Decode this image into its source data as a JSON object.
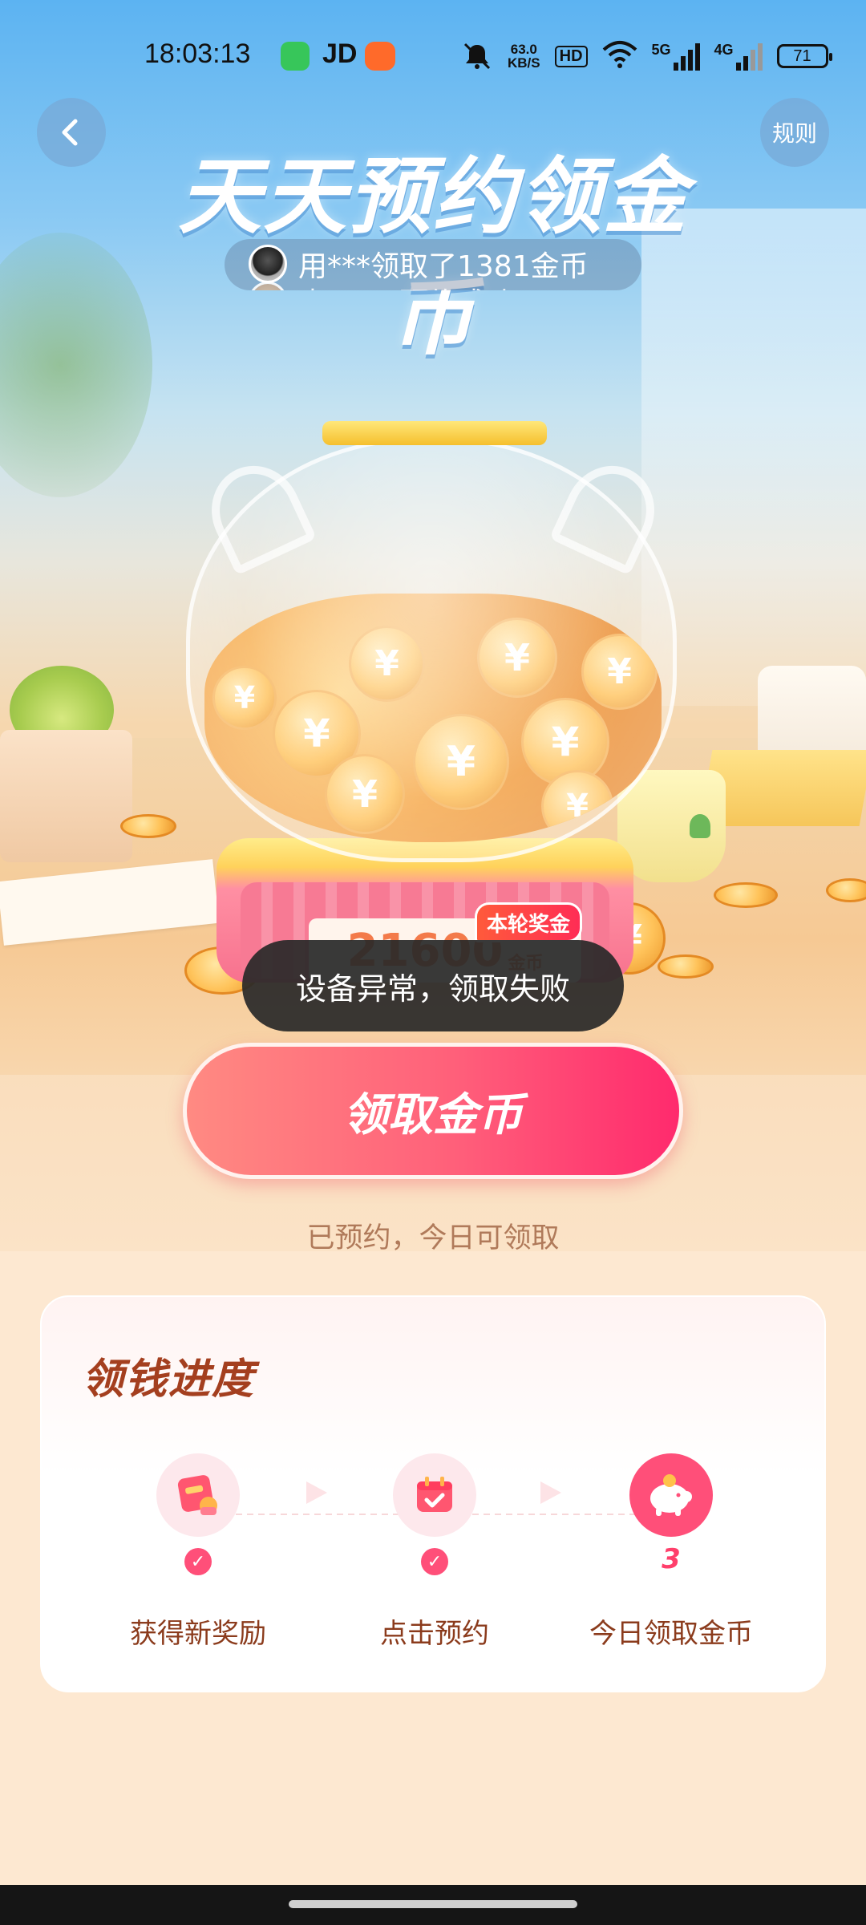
{
  "status_bar": {
    "time": "18:03:13",
    "jd_label": "JD",
    "network_speed": "63.0",
    "network_speed_unit": "KB/S",
    "hd_label": "HD",
    "signal_5g": "5G",
    "signal_4g": "4G",
    "battery": "71"
  },
  "header": {
    "back_icon": "chevron-left-icon",
    "rules_label": "规则",
    "title": "天天预约领金币"
  },
  "ticker": {
    "items": [
      {
        "text": "用***领取了1381金币"
      },
      {
        "text": "李***已预约成功"
      }
    ]
  },
  "prize": {
    "tag": "本轮奖金",
    "amount": "21600",
    "unit": "金币"
  },
  "toast": {
    "message": "设备异常，领取失败"
  },
  "claim": {
    "button_label": "领取金币",
    "hint": "已预约，今日可领取"
  },
  "progress": {
    "title": "领钱进度",
    "steps": [
      {
        "label": "获得新奖励",
        "status": "done",
        "icon": "red-envelope-icon"
      },
      {
        "label": "点击预约",
        "status": "done",
        "icon": "calendar-check-icon"
      },
      {
        "label": "今日领取金币",
        "status": "current",
        "number": "3",
        "icon": "piggy-bank-icon"
      }
    ]
  },
  "colors": {
    "accent": "#ff4f79",
    "title_brown": "#a43f1f",
    "button_start": "#ff8a82",
    "button_end": "#ff2a6d"
  }
}
